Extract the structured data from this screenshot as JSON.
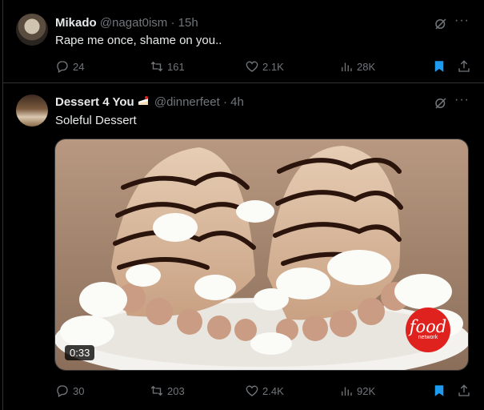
{
  "tweets": [
    {
      "name": "Mikado",
      "handle": "@nagat0ism",
      "separator": "·",
      "time": "15h",
      "text": "Rape me once, shame on you..",
      "stats": {
        "replies": "24",
        "reposts": "161",
        "likes": "2.1K",
        "views": "28K"
      }
    },
    {
      "name": "Dessert 4 You",
      "handle": "@dinnerfeet",
      "separator": "·",
      "time": "4h",
      "text": "Soleful Dessert",
      "video": {
        "duration": "0:33",
        "watermark_top": "food",
        "watermark_bottom": "network"
      },
      "stats": {
        "replies": "30",
        "reposts": "203",
        "likes": "2.4K",
        "views": "92K"
      }
    }
  ],
  "icons": [
    "reply-icon",
    "repost-icon",
    "like-icon",
    "views-icon",
    "bookmark-icon",
    "share-icon",
    "grok-icon",
    "more-icon",
    "cake-emoji-icon"
  ],
  "colors": {
    "background": "#000000",
    "text": "#e7e9ea",
    "muted": "#71767b",
    "bookmark_active": "#1d9bf0",
    "divider": "#2f3336"
  }
}
